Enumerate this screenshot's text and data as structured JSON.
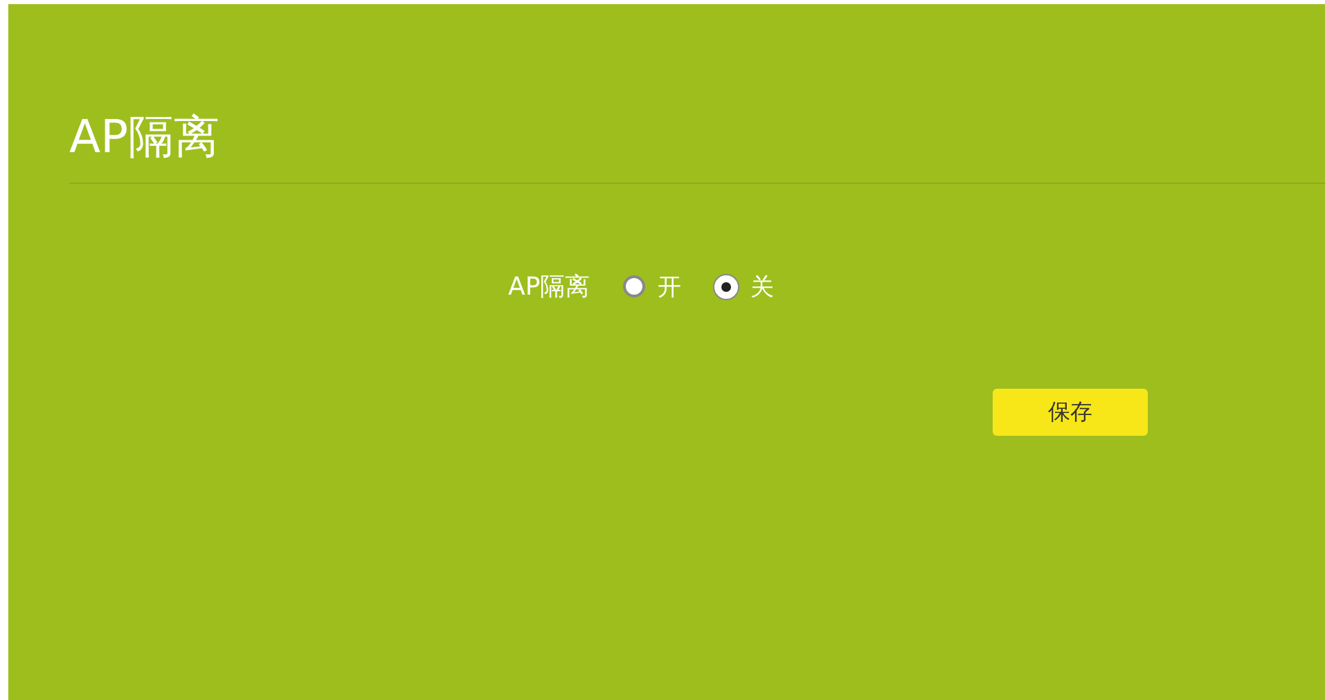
{
  "page": {
    "title": "AP隔离"
  },
  "setting": {
    "label": "AP隔离",
    "options": [
      {
        "label": "开",
        "selected": false
      },
      {
        "label": "关",
        "selected": true
      }
    ]
  },
  "buttons": [
    {
      "label": "保存"
    }
  ]
}
